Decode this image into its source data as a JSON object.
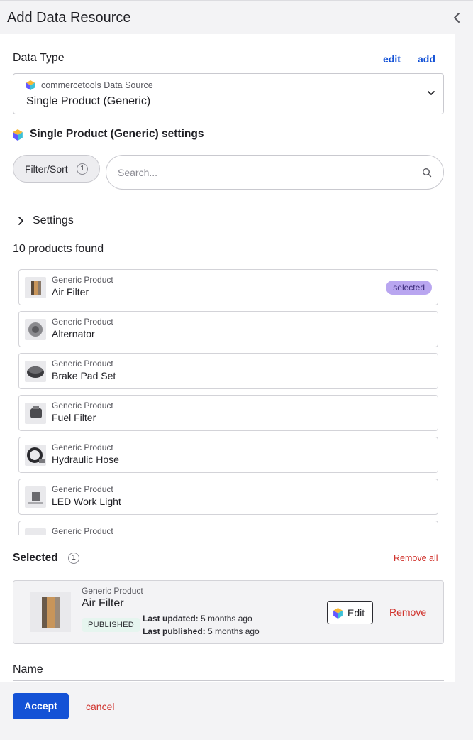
{
  "header": {
    "title": "Add Data Resource",
    "collapse_icon": "chevron-left-icon"
  },
  "data_type": {
    "label": "Data Type",
    "edit_label": "edit",
    "add_label": "add",
    "select": {
      "source": "commercetools Data Source",
      "value": "Single Product (Generic)"
    }
  },
  "settings_title": "Single Product (Generic) settings",
  "filter": {
    "label": "Filter/Sort",
    "count": "1"
  },
  "search": {
    "placeholder": "Search..."
  },
  "settings_accordion": {
    "label": "Settings"
  },
  "products_count": "10 products found",
  "products": [
    {
      "type": "Generic Product",
      "name": "Air Filter",
      "selected": "selected"
    },
    {
      "type": "Generic Product",
      "name": "Alternator"
    },
    {
      "type": "Generic Product",
      "name": "Brake Pad Set"
    },
    {
      "type": "Generic Product",
      "name": "Fuel Filter"
    },
    {
      "type": "Generic Product",
      "name": "Hydraulic Hose"
    },
    {
      "type": "Generic Product",
      "name": "LED Work Light"
    },
    {
      "type": "Generic Product",
      "name": ""
    }
  ],
  "selected": {
    "title": "Selected",
    "count": "1",
    "remove_all": "Remove all",
    "item": {
      "type": "Generic Product",
      "name": "Air Filter",
      "status": "PUBLISHED",
      "last_updated_label": "Last updated:",
      "last_updated_value": "5 months ago",
      "last_published_label": "Last published:",
      "last_published_value": "5 months ago",
      "edit_label": "Edit",
      "remove_label": "Remove"
    }
  },
  "name_field": {
    "label": "Name"
  },
  "footer": {
    "accept": "Accept",
    "cancel": "cancel"
  },
  "colors": {
    "primary": "#1452d6",
    "danger": "#d0322c",
    "selected_badge": "#b9a6f0",
    "published_badge": "#e6f5ef"
  }
}
